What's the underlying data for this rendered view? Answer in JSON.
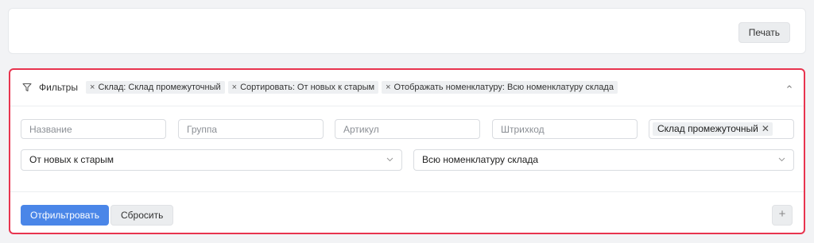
{
  "toolbar": {
    "print_label": "Печать"
  },
  "filters": {
    "title": "Фильтры",
    "chips": [
      {
        "remove": "×",
        "label": "Склад: Склад промежуточный"
      },
      {
        "remove": "×",
        "label": "Сортировать: От новых к старым"
      },
      {
        "remove": "×",
        "label": "Отображать номенклатуру: Всю номенклатуру склада"
      }
    ],
    "fields": {
      "name_placeholder": "Название",
      "group_placeholder": "Группа",
      "article_placeholder": "Артикул",
      "barcode_placeholder": "Штрихкод",
      "warehouse_tag": "Склад промежуточный",
      "warehouse_tag_remove": "✕"
    },
    "sort": {
      "selected": "От новых к старым"
    },
    "nomenclature": {
      "selected": "Всю номенклатуру склада"
    },
    "apply_label": "Отфильтровать",
    "reset_label": "Сбросить",
    "add_label": "+"
  },
  "colors": {
    "accent": "#4a86e8",
    "highlight_border": "#e8344f"
  }
}
